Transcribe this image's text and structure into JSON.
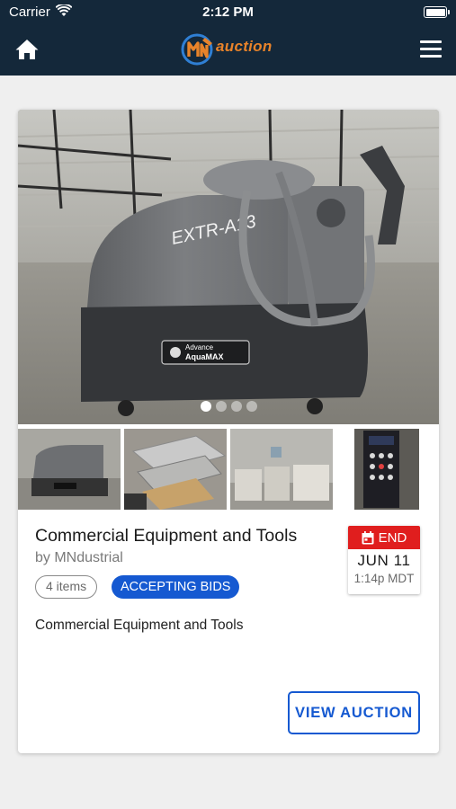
{
  "status_bar": {
    "carrier": "Carrier",
    "time": "2:12 PM",
    "wifi_icon": "wifi-icon",
    "battery_icon": "battery-icon"
  },
  "nav": {
    "home_icon": "home-icon",
    "logo_text": "auction",
    "logo_mark_text": "MN",
    "menu_icon": "hamburger-menu-icon"
  },
  "card": {
    "title": "Commercial Equipment and Tools",
    "seller": "by MNdustrial",
    "items_count": "4 items",
    "status": "ACCEPTING BIDS",
    "description": "Commercial Equipment and Tools",
    "end_label": "END",
    "end_date": "JUN 11",
    "end_time": "1:14p MDT",
    "view_button": "VIEW AUCTION",
    "hero_markings": {
      "handwritten": "EXTR-A13",
      "brand_top": "Advance",
      "brand_bottom": "AquaMAX"
    },
    "carousel": {
      "total": 4,
      "active": 1
    },
    "thumbnails": [
      {
        "name": "thumb-carpet-extractor"
      },
      {
        "name": "thumb-metal-pans"
      },
      {
        "name": "thumb-warehouse-equipment"
      },
      {
        "name": "thumb-control-panel"
      }
    ]
  },
  "colors": {
    "header_bg": "#14283a",
    "accent_blue": "#1559d1",
    "end_red": "#e01e1e",
    "logo_orange": "#e8832a"
  }
}
